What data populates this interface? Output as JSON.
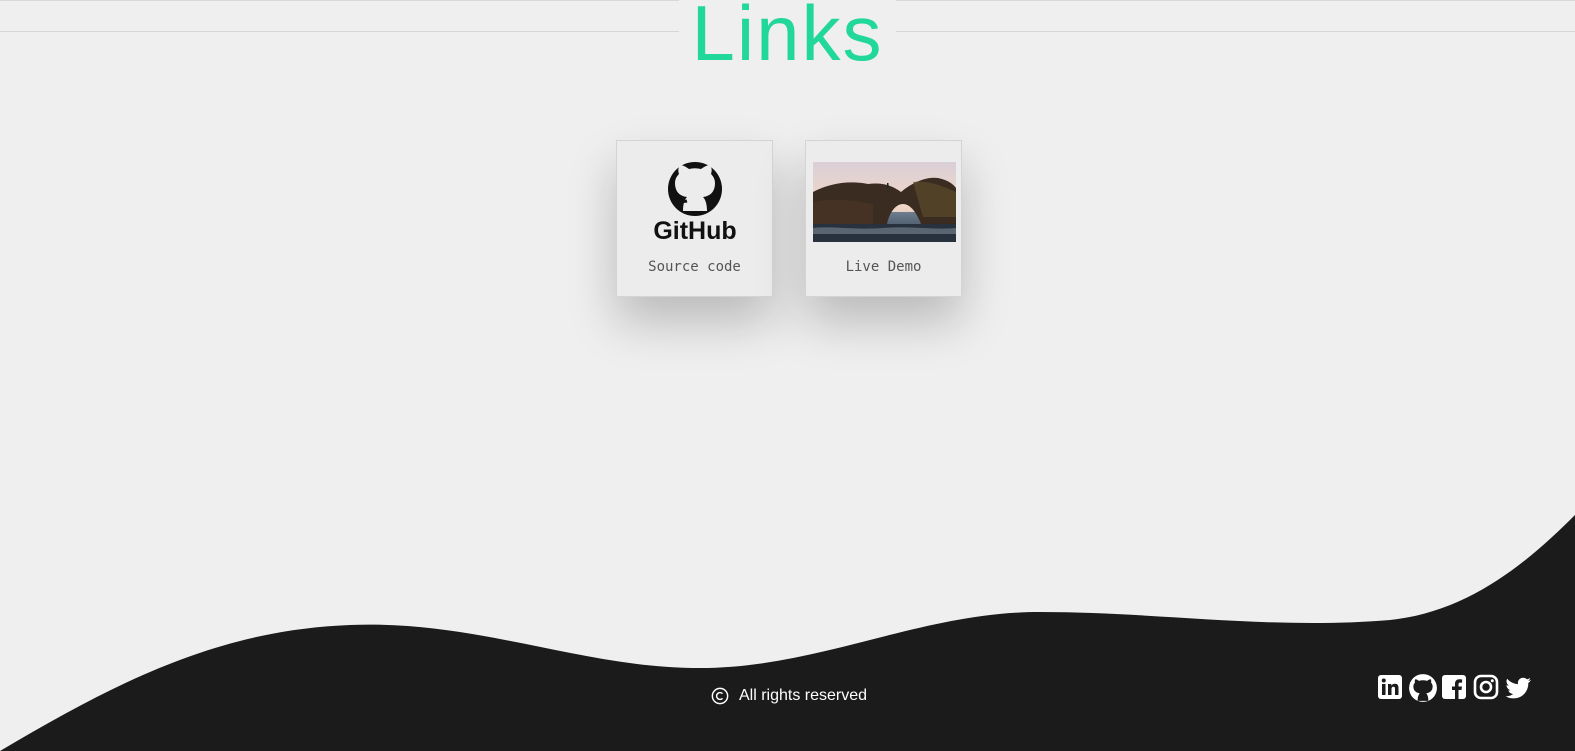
{
  "header": {
    "title": "Links"
  },
  "cards": [
    {
      "label": "Source code",
      "image": "github-logo",
      "logo_text": "GitHub"
    },
    {
      "label": "Live Demo",
      "image": "rock-arch-photo"
    }
  ],
  "footer": {
    "copyright_icon": "copyright-icon",
    "copyright_text": "All rights reserved",
    "social_icons": [
      "linkedin-icon",
      "github-icon",
      "facebook-icon",
      "instagram-icon",
      "twitter-icon"
    ]
  },
  "colors": {
    "accent": "#22d79a",
    "background": "#efefef",
    "footer": "#1b1b1b",
    "footer_text": "#ffffff"
  }
}
